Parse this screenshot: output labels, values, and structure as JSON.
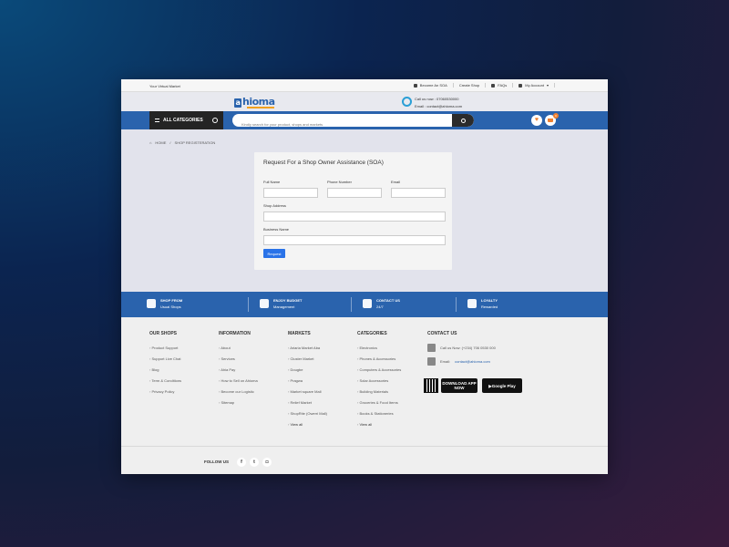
{
  "topbar": {
    "tagline": "Your Virtual Market",
    "links": [
      "Become An SOA",
      "Create Shop",
      "FAQs",
      "My Account"
    ]
  },
  "header": {
    "logo_letter": "a",
    "logo_text": "hioma",
    "call_text": "Call us now : 07060530000",
    "email_text": "Email : contact@ahioma.com"
  },
  "nav": {
    "all_categories": "ALL CATEGORIES",
    "search_placeholder": "Kindly search for your product, shops and markets",
    "cart_count": "0"
  },
  "breadcrumb": {
    "home": "HOME",
    "current": "SHOP REGISTERATION"
  },
  "form": {
    "title": "Request For a Shop Owner Assistance (SOA)",
    "full_name_label": "Full Name",
    "phone_label": "Phone Number",
    "email_label": "Email",
    "address_label": "Shop Address",
    "business_label": "Business Name",
    "submit_label": "Request"
  },
  "features": [
    {
      "title": "SHOP FROM",
      "sub": "Usual Shops",
      "icon": "cart-icon"
    },
    {
      "title": "ENJOY BUDGET",
      "sub": "Management",
      "icon": "money-icon"
    },
    {
      "title": "CONTACT US",
      "sub": "24/7",
      "icon": "phone-icon"
    },
    {
      "title": "LOYALTY",
      "sub": "Rewarded",
      "icon": "users-icon"
    }
  ],
  "footer": {
    "our_shops": {
      "title": "OUR SHOPS",
      "items": [
        "Product Support",
        "Support Live Chat",
        "Blog",
        "Term & Conditions",
        "Privacy Policy"
      ]
    },
    "information": {
      "title": "INFORMATION",
      "items": [
        "About",
        "Services",
        "Ahia Pay",
        "How to Sell on Ahioma",
        "Become our Logistic",
        "Sitemap"
      ]
    },
    "markets": {
      "title": "MARKETS",
      "items": [
        "Ariaria Market Aba",
        "Cluster Market",
        "Dougbe",
        "Pragwa",
        "Market square Mall",
        "Relief Market",
        "ShopRite (Owerri Mall)",
        "View all"
      ]
    },
    "categories": {
      "title": "CATEGORIES",
      "items": [
        "Electronics",
        "Phones & Accessories",
        "Computers & Accessories",
        "Solar Accessories",
        "Building Materials",
        "Groceries & Food Items",
        "Books & Stationeries",
        "View all"
      ]
    },
    "contact": {
      "title": "CONTACT US",
      "phone": "Call us Now: (+234) 706 0530 000",
      "email_label": "Email:",
      "email": "contact@ahioma.com",
      "app_store": "DOWNLOAD APP NOW",
      "google_play": "Google Play"
    }
  },
  "follow": {
    "label": "FOLLOW US",
    "facebook": "f",
    "twitter": "t",
    "instagram": "◘"
  }
}
